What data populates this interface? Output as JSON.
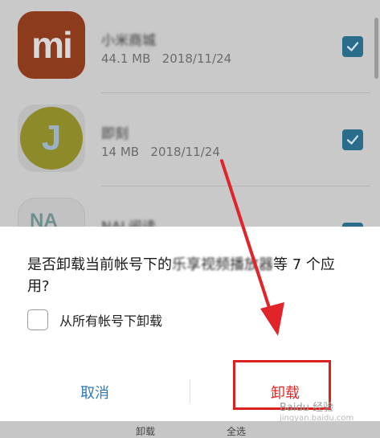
{
  "apps": [
    {
      "name": "小米商城",
      "size": "44.1 MB",
      "date": "2018/11/24",
      "icon": "mi-logo-icon",
      "icon_glyph": "mi",
      "checked": true
    },
    {
      "name": "即刻",
      "size": "14 MB",
      "date": "2018/11/24",
      "icon": "j-logo-icon",
      "icon_glyph": "J",
      "checked": true
    },
    {
      "name": "NAL阅读",
      "size": "",
      "date": "",
      "icon": "app-logo-icon",
      "icon_glyph": "NA",
      "checked": true
    }
  ],
  "dialog": {
    "message_part1": "是否卸载当前帐号下的",
    "message_blurred": "乐享视频播放器",
    "message_part2": "等 7 个应用?",
    "checkbox_label": "从所有帐号下卸载",
    "checkbox_checked": false,
    "cancel_label": "取消",
    "uninstall_label": "卸载"
  },
  "bottom_bar": {
    "uninstall_label": "卸载",
    "select_all_label": "全选"
  },
  "watermark": {
    "title": "Baidu 经验",
    "url": "jingyan.baidu.com"
  },
  "colors": {
    "accent_blue": "#2f79b7",
    "danger_red": "#e02b2b",
    "annotation_red": "#d9221f"
  }
}
